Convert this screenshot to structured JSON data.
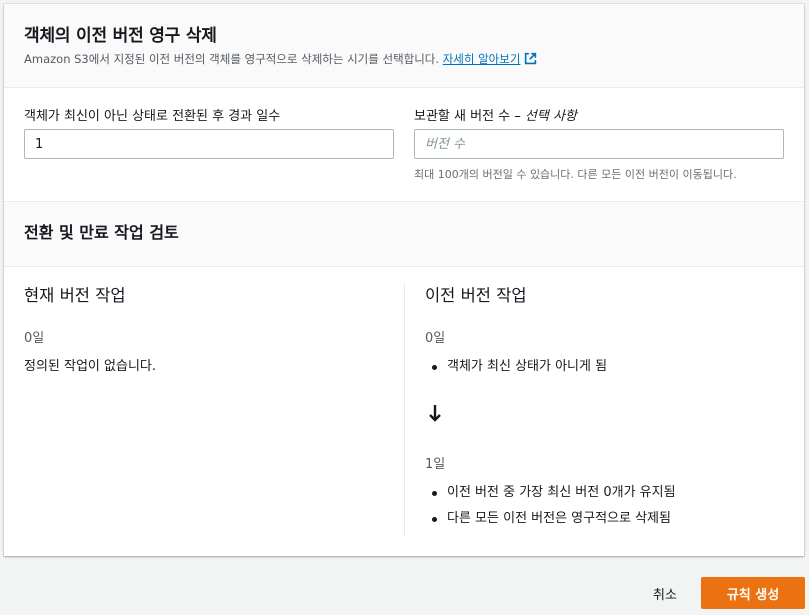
{
  "header": {
    "title": "객체의 이전 버전 영구 삭제",
    "description": "Amazon S3에서 지정된 이전 버전의 객체를 영구적으로 삭제하는 시기를 선택합니다.",
    "learn_more_link": "자세히 알아보기",
    "learn_more_icon": "external-link-icon"
  },
  "form": {
    "days_label": "객체가 최신이 아닌 상태로 전환된 후 경과 일수",
    "days_value": "1",
    "versions_label": "보관할 새 버전 수",
    "versions_label_optional": "– 선택 사항",
    "versions_placeholder": "버전 수",
    "versions_hint": "최대 100개의 버전일 수 있습니다. 다른 모든 이전 버전이 이동됩니다."
  },
  "review": {
    "title": "전환 및 만료 작업 검토",
    "current": {
      "title": "현재 버전 작업",
      "day_label": "0일",
      "empty_text": "정의된 작업이 없습니다."
    },
    "previous": {
      "title": "이전 버전 작업",
      "step1_day": "0일",
      "step1_items": [
        "객체가 최신 상태가 아니게 됨"
      ],
      "arrow_icon": "arrow-down-icon",
      "step2_day": "1일",
      "step2_items": [
        "이전 버전 중 가장 최신 버전 0개가 유지됨",
        "다른 모든 이전 버전은 영구적으로 삭제됨"
      ]
    }
  },
  "footer": {
    "cancel_label": "취소",
    "create_label": "규칙 생성"
  },
  "colors": {
    "primary": "#ec7211",
    "link": "#0073bb"
  }
}
